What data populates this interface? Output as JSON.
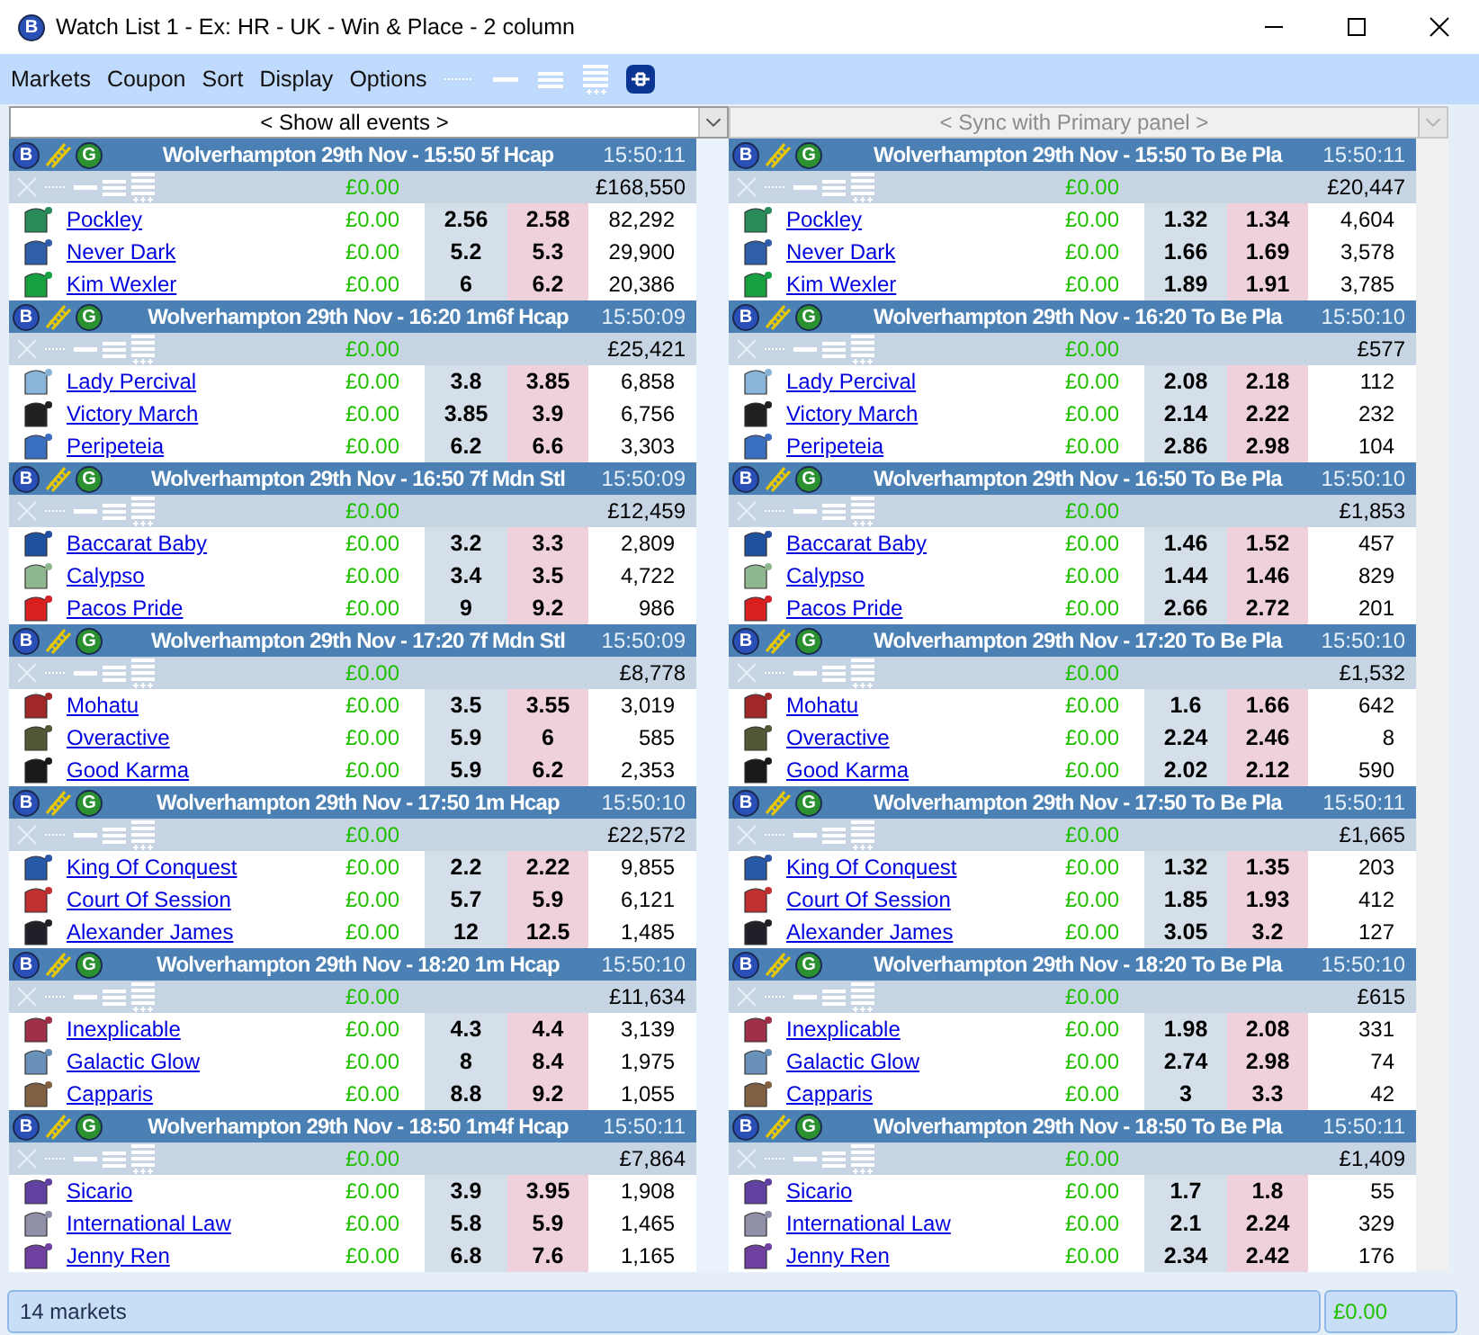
{
  "window": {
    "icon_letter": "B",
    "title": "Watch List 1 - Ex: HR - UK - Win & Place - 2 column"
  },
  "menu": [
    "Markets",
    "Coupon",
    "Sort",
    "Display",
    "Options"
  ],
  "panels": [
    {
      "selector": {
        "text": "< Show all events >",
        "disabled": false
      },
      "markets": [
        {
          "badges": [
            "B",
            "G"
          ],
          "title": "Wolverhampton 29th Nov - 15:50 5f Hcap",
          "time": "15:50:11",
          "profit": "£0.00",
          "matched": "£168,550",
          "runners": [
            {
              "name": "Pockley",
              "color": "#2a8a5a",
              "profit": "£0.00",
              "back": "2.56",
              "lay": "2.58",
              "volume": "82,292"
            },
            {
              "name": "Never Dark",
              "color": "#2f5fa8",
              "profit": "£0.00",
              "back": "5.2",
              "lay": "5.3",
              "volume": "29,900"
            },
            {
              "name": "Kim Wexler",
              "color": "#18a040",
              "profit": "£0.00",
              "back": "6",
              "lay": "6.2",
              "volume": "20,386"
            }
          ]
        },
        {
          "badges": [
            "B",
            "G"
          ],
          "title": "Wolverhampton 29th Nov - 16:20 1m6f Hcap",
          "time": "15:50:09",
          "profit": "£0.00",
          "matched": "£25,421",
          "runners": [
            {
              "name": "Lady Percival",
              "color": "#8ab4d8",
              "profit": "£0.00",
              "back": "3.8",
              "lay": "3.85",
              "volume": "6,858"
            },
            {
              "name": "Victory March",
              "color": "#202020",
              "profit": "£0.00",
              "back": "3.85",
              "lay": "3.9",
              "volume": "6,756"
            },
            {
              "name": "Peripeteia",
              "color": "#3a6fc0",
              "profit": "£0.00",
              "back": "6.2",
              "lay": "6.6",
              "volume": "3,303"
            }
          ]
        },
        {
          "badges": [
            "B",
            "G"
          ],
          "title": "Wolverhampton 29th Nov - 16:50 7f Mdn Stl",
          "time": "15:50:09",
          "profit": "£0.00",
          "matched": "£12,459",
          "runners": [
            {
              "name": "Baccarat Baby",
              "color": "#2050a0",
              "profit": "£0.00",
              "back": "3.2",
              "lay": "3.3",
              "volume": "2,809"
            },
            {
              "name": "Calypso",
              "color": "#90b890",
              "profit": "£0.00",
              "back": "3.4",
              "lay": "3.5",
              "volume": "4,722"
            },
            {
              "name": "Pacos Pride",
              "color": "#d82020",
              "profit": "£0.00",
              "back": "9",
              "lay": "9.2",
              "volume": "986"
            }
          ]
        },
        {
          "badges": [
            "B",
            "G"
          ],
          "title": "Wolverhampton 29th Nov - 17:20 7f Mdn Stl",
          "time": "15:50:09",
          "profit": "£0.00",
          "matched": "£8,778",
          "runners": [
            {
              "name": "Mohatu",
              "color": "#a02828",
              "profit": "£0.00",
              "back": "3.5",
              "lay": "3.55",
              "volume": "3,019"
            },
            {
              "name": "Overactive",
              "color": "#505838",
              "profit": "£0.00",
              "back": "5.9",
              "lay": "6",
              "volume": "585"
            },
            {
              "name": "Good Karma",
              "color": "#1a1a1a",
              "profit": "£0.00",
              "back": "5.9",
              "lay": "6.2",
              "volume": "2,353"
            }
          ]
        },
        {
          "badges": [
            "B",
            "G"
          ],
          "title": "Wolverhampton 29th Nov - 17:50 1m Hcap",
          "time": "15:50:10",
          "profit": "£0.00",
          "matched": "£22,572",
          "runners": [
            {
              "name": "King Of Conquest",
              "color": "#2858a8",
              "profit": "£0.00",
              "back": "2.2",
              "lay": "2.22",
              "volume": "9,855"
            },
            {
              "name": "Court Of Session",
              "color": "#c03030",
              "profit": "£0.00",
              "back": "5.7",
              "lay": "5.9",
              "volume": "6,121"
            },
            {
              "name": "Alexander James",
              "color": "#202028",
              "profit": "£0.00",
              "back": "12",
              "lay": "12.5",
              "volume": "1,485"
            }
          ]
        },
        {
          "badges": [
            "B",
            "G"
          ],
          "title": "Wolverhampton 29th Nov - 18:20 1m Hcap",
          "time": "15:50:10",
          "profit": "£0.00",
          "matched": "£11,634",
          "runners": [
            {
              "name": "Inexplicable",
              "color": "#a03048",
              "profit": "£0.00",
              "back": "4.3",
              "lay": "4.4",
              "volume": "3,139"
            },
            {
              "name": "Galactic Glow",
              "color": "#6890b8",
              "profit": "£0.00",
              "back": "8",
              "lay": "8.4",
              "volume": "1,975"
            },
            {
              "name": "Capparis",
              "color": "#806040",
              "profit": "£0.00",
              "back": "8.8",
              "lay": "9.2",
              "volume": "1,055"
            }
          ]
        },
        {
          "badges": [
            "B",
            "G"
          ],
          "title": "Wolverhampton 29th Nov - 18:50 1m4f Hcap",
          "time": "15:50:11",
          "profit": "£0.00",
          "matched": "£7,864",
          "runners": [
            {
              "name": "Sicario",
              "color": "#6040a0",
              "profit": "£0.00",
              "back": "3.9",
              "lay": "3.95",
              "volume": "1,908"
            },
            {
              "name": "International Law",
              "color": "#9090a8",
              "profit": "£0.00",
              "back": "5.8",
              "lay": "5.9",
              "volume": "1,465"
            },
            {
              "name": "Jenny Ren",
              "color": "#7040a0",
              "profit": "£0.00",
              "back": "6.8",
              "lay": "7.6",
              "volume": "1,165"
            }
          ]
        }
      ]
    },
    {
      "selector": {
        "text": "< Sync with Primary panel >",
        "disabled": true
      },
      "markets": [
        {
          "badges": [
            "B",
            "G"
          ],
          "title": "Wolverhampton 29th Nov - 15:50 To Be Pla",
          "time": "15:50:11",
          "profit": "£0.00",
          "matched": "£20,447",
          "runners": [
            {
              "name": "Pockley",
              "color": "#2a8a5a",
              "profit": "£0.00",
              "back": "1.32",
              "lay": "1.34",
              "volume": "4,604"
            },
            {
              "name": "Never Dark",
              "color": "#2f5fa8",
              "profit": "£0.00",
              "back": "1.66",
              "lay": "1.69",
              "volume": "3,578"
            },
            {
              "name": "Kim Wexler",
              "color": "#18a040",
              "profit": "£0.00",
              "back": "1.89",
              "lay": "1.91",
              "volume": "3,785"
            }
          ]
        },
        {
          "badges": [
            "B",
            "G"
          ],
          "title": "Wolverhampton 29th Nov - 16:20 To Be Pla",
          "time": "15:50:10",
          "profit": "£0.00",
          "matched": "£577",
          "runners": [
            {
              "name": "Lady Percival",
              "color": "#8ab4d8",
              "profit": "£0.00",
              "back": "2.08",
              "lay": "2.18",
              "volume": "112"
            },
            {
              "name": "Victory March",
              "color": "#202020",
              "profit": "£0.00",
              "back": "2.14",
              "lay": "2.22",
              "volume": "232"
            },
            {
              "name": "Peripeteia",
              "color": "#3a6fc0",
              "profit": "£0.00",
              "back": "2.86",
              "lay": "2.98",
              "volume": "104"
            }
          ]
        },
        {
          "badges": [
            "B",
            "G"
          ],
          "title": "Wolverhampton 29th Nov - 16:50 To Be Pla",
          "time": "15:50:10",
          "profit": "£0.00",
          "matched": "£1,853",
          "runners": [
            {
              "name": "Baccarat Baby",
              "color": "#2050a0",
              "profit": "£0.00",
              "back": "1.46",
              "lay": "1.52",
              "volume": "457"
            },
            {
              "name": "Calypso",
              "color": "#90b890",
              "profit": "£0.00",
              "back": "1.44",
              "lay": "1.46",
              "volume": "829"
            },
            {
              "name": "Pacos Pride",
              "color": "#d82020",
              "profit": "£0.00",
              "back": "2.66",
              "lay": "2.72",
              "volume": "201"
            }
          ]
        },
        {
          "badges": [
            "B",
            "G"
          ],
          "title": "Wolverhampton 29th Nov - 17:20 To Be Pla",
          "time": "15:50:10",
          "profit": "£0.00",
          "matched": "£1,532",
          "runners": [
            {
              "name": "Mohatu",
              "color": "#a02828",
              "profit": "£0.00",
              "back": "1.6",
              "lay": "1.66",
              "volume": "642"
            },
            {
              "name": "Overactive",
              "color": "#505838",
              "profit": "£0.00",
              "back": "2.24",
              "lay": "2.46",
              "volume": "8"
            },
            {
              "name": "Good Karma",
              "color": "#1a1a1a",
              "profit": "£0.00",
              "back": "2.02",
              "lay": "2.12",
              "volume": "590"
            }
          ]
        },
        {
          "badges": [
            "B",
            "G"
          ],
          "title": "Wolverhampton 29th Nov - 17:50 To Be Pla",
          "time": "15:50:11",
          "profit": "£0.00",
          "matched": "£1,665",
          "runners": [
            {
              "name": "King Of Conquest",
              "color": "#2858a8",
              "profit": "£0.00",
              "back": "1.32",
              "lay": "1.35",
              "volume": "203"
            },
            {
              "name": "Court Of Session",
              "color": "#c03030",
              "profit": "£0.00",
              "back": "1.85",
              "lay": "1.93",
              "volume": "412"
            },
            {
              "name": "Alexander James",
              "color": "#202028",
              "profit": "£0.00",
              "back": "3.05",
              "lay": "3.2",
              "volume": "127"
            }
          ]
        },
        {
          "badges": [
            "B",
            "G"
          ],
          "title": "Wolverhampton 29th Nov - 18:20 To Be Pla",
          "time": "15:50:10",
          "profit": "£0.00",
          "matched": "£615",
          "runners": [
            {
              "name": "Inexplicable",
              "color": "#a03048",
              "profit": "£0.00",
              "back": "1.98",
              "lay": "2.08",
              "volume": "331"
            },
            {
              "name": "Galactic Glow",
              "color": "#6890b8",
              "profit": "£0.00",
              "back": "2.74",
              "lay": "2.98",
              "volume": "74"
            },
            {
              "name": "Capparis",
              "color": "#806040",
              "profit": "£0.00",
              "back": "3",
              "lay": "3.3",
              "volume": "42"
            }
          ]
        },
        {
          "badges": [
            "B",
            "G"
          ],
          "title": "Wolverhampton 29th Nov - 18:50 To Be Pla",
          "time": "15:50:11",
          "profit": "£0.00",
          "matched": "£1,409",
          "runners": [
            {
              "name": "Sicario",
              "color": "#6040a0",
              "profit": "£0.00",
              "back": "1.7",
              "lay": "1.8",
              "volume": "55"
            },
            {
              "name": "International Law",
              "color": "#9090a8",
              "profit": "£0.00",
              "back": "2.1",
              "lay": "2.24",
              "volume": "329"
            },
            {
              "name": "Jenny Ren",
              "color": "#7040a0",
              "profit": "£0.00",
              "back": "2.34",
              "lay": "2.42",
              "volume": "176"
            }
          ]
        }
      ]
    }
  ],
  "status_bar": {
    "text": "14 markets",
    "total": "£0.00"
  }
}
